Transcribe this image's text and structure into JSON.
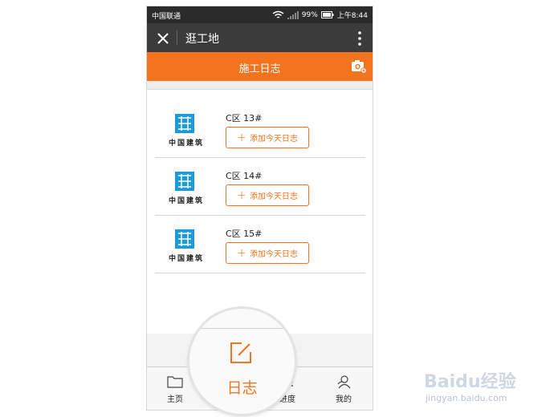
{
  "status_bar": {
    "carrier": "中国联通",
    "battery": "99%",
    "time": "上午8:44"
  },
  "title_bar": {
    "title": "逛工地"
  },
  "header": {
    "title": "施工日志"
  },
  "list": {
    "items": [
      {
        "name": "C区 13#",
        "logo_text": "中国建筑",
        "add_label": "添加今天日志"
      },
      {
        "name": "C区 14#",
        "logo_text": "中国建筑",
        "add_label": "添加今天日志"
      },
      {
        "name": "C区 15#",
        "logo_text": "中国建筑",
        "add_label": "添加今天日志"
      }
    ]
  },
  "tabbar": {
    "tabs": [
      {
        "label": "主页",
        "icon": "folder-icon"
      },
      {
        "label": "日志",
        "icon": "edit-icon"
      },
      {
        "label": "进度",
        "icon": "progress-icon"
      },
      {
        "label": "我的",
        "icon": "user-icon"
      }
    ]
  },
  "magnifier": {
    "label": "日志",
    "icon": "edit-icon"
  },
  "watermark": {
    "brand": "Baidu经验",
    "url": "jingyan.baidu.com"
  },
  "colors": {
    "accent": "#f2741f",
    "title_bar": "#3b3b3b",
    "status_bar": "#2b2b2b",
    "logo_blue": "#1c9bd8"
  }
}
